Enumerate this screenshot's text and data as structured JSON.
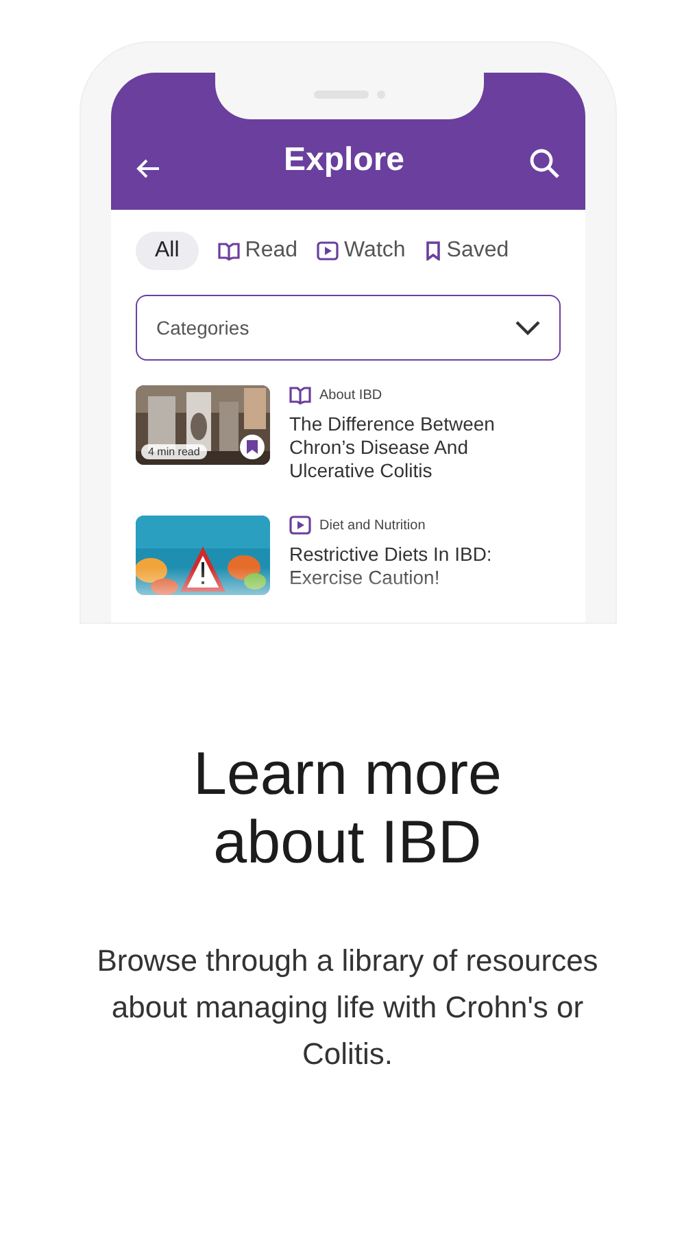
{
  "header": {
    "title": "Explore"
  },
  "tabs": [
    {
      "label": "All",
      "kind": "all",
      "selected": true
    },
    {
      "label": "Read",
      "kind": "read",
      "selected": false
    },
    {
      "label": "Watch",
      "kind": "watch",
      "selected": false
    },
    {
      "label": "Saved",
      "kind": "saved",
      "selected": false
    }
  ],
  "category_select": {
    "placeholder": "Categories"
  },
  "articles": [
    {
      "kind": "read",
      "category": "About IBD",
      "title": "The Difference Between Chron’s Disease And Ulcerative Colitis",
      "badge": "4 min read",
      "saved": true
    },
    {
      "kind": "watch",
      "category": "Diet and Nutrition",
      "title": "Restrictive Diets In IBD: Exercise Caution!",
      "saved": false
    }
  ],
  "headline": "Learn more about IBD",
  "description": "Browse through a library of resources about managing life with Crohn's or Colitis."
}
